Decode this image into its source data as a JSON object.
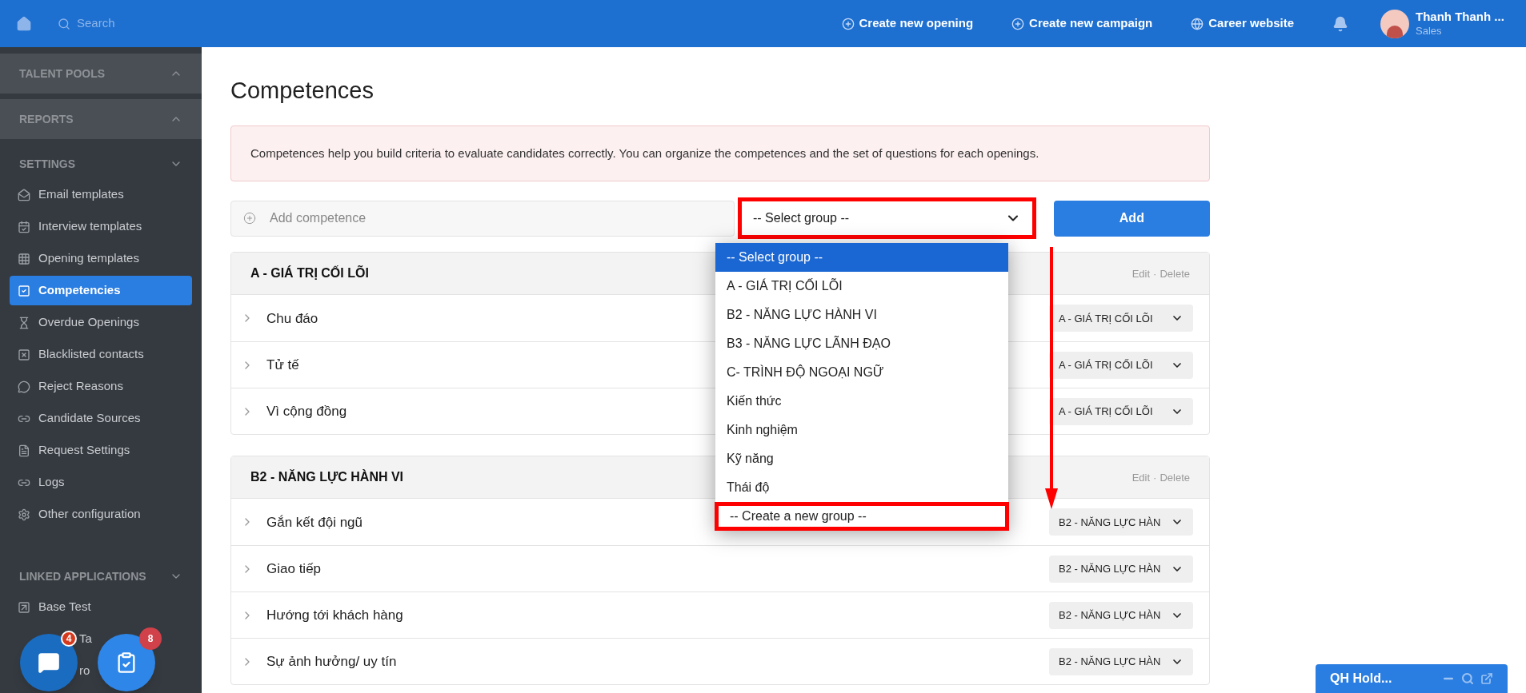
{
  "topbar": {
    "search_placeholder": "Search",
    "links": [
      "Create new opening",
      "Create new campaign",
      "Career website"
    ],
    "user": {
      "name": "Thanh Thanh ...",
      "role": "Sales"
    }
  },
  "sidebar": {
    "sections": [
      {
        "title": "TALENT POOLS",
        "expanded": false
      },
      {
        "title": "REPORTS",
        "expanded": false
      },
      {
        "title": "SETTINGS",
        "expanded": true,
        "items": [
          {
            "label": "Email templates",
            "selected": false
          },
          {
            "label": "Interview templates",
            "selected": false
          },
          {
            "label": "Opening templates",
            "selected": false
          },
          {
            "label": "Competencies",
            "selected": true
          },
          {
            "label": "Overdue Openings",
            "selected": false
          },
          {
            "label": "Blacklisted contacts",
            "selected": false
          },
          {
            "label": "Reject Reasons",
            "selected": false
          },
          {
            "label": "Candidate Sources",
            "selected": false
          },
          {
            "label": "Request Settings",
            "selected": false
          },
          {
            "label": "Logs",
            "selected": false
          },
          {
            "label": "Other configuration",
            "selected": false
          }
        ]
      },
      {
        "title": "LINKED APPLICATIONS",
        "expanded": true,
        "items": [
          {
            "label": "Base Test",
            "selected": false
          },
          {
            "label": "Ta",
            "selected": false
          },
          {
            "label": "ro",
            "selected": false
          }
        ]
      }
    ]
  },
  "floating_buttons": [
    {
      "badge": "4"
    },
    {
      "badge": "8"
    }
  ],
  "page": {
    "title": "Competences",
    "info": "Competences help you build criteria to evaluate candidates correctly. You can organize the competences and the set of questions for each openings.",
    "add_field": {
      "placeholder": "Add competence"
    },
    "group_select": {
      "value": "-- Select group --",
      "highlighted": true
    },
    "add_button": "Add",
    "dropdown": {
      "options": [
        {
          "label": "-- Select group --",
          "selected": true,
          "highlighted": false
        },
        {
          "label": "A - GIÁ TRỊ CỐI LÕI",
          "selected": false,
          "highlighted": false
        },
        {
          "label": "B2 - NĂNG LỰC HÀNH VI",
          "selected": false,
          "highlighted": false
        },
        {
          "label": "B3 - NĂNG LỰC LÃNH ĐẠO",
          "selected": false,
          "highlighted": false
        },
        {
          "label": "C- TRÌNH ĐỘ NGOẠI NGỮ",
          "selected": false,
          "highlighted": false
        },
        {
          "label": "Kiến thức",
          "selected": false,
          "highlighted": false
        },
        {
          "label": "Kinh nghiệm",
          "selected": false,
          "highlighted": false
        },
        {
          "label": "Kỹ năng",
          "selected": false,
          "highlighted": false
        },
        {
          "label": "Thái độ",
          "selected": false,
          "highlighted": false
        },
        {
          "label": "-- Create a new group --",
          "selected": false,
          "highlighted": true
        }
      ]
    },
    "groups": [
      {
        "title": "A - GIÁ TRỊ CỐI LÕI",
        "edit": "Edit",
        "separator": "·",
        "delete": "Delete",
        "items": [
          {
            "name": "Chu đáo",
            "group": "A - GIÁ TRỊ CỐI LÕI"
          },
          {
            "name": "Tử tế",
            "group": "A - GIÁ TRỊ CỐI LÕI"
          },
          {
            "name": "Vì cộng đồng",
            "group": "A - GIÁ TRỊ CỐI LÕI"
          }
        ]
      },
      {
        "title": "B2 - NĂNG LỰC HÀNH VI",
        "edit": "Edit",
        "separator": "·",
        "delete": "Delete",
        "items": [
          {
            "name": "Gắn kết đội ngũ",
            "group": "B2 - NĂNG LỰC HÀN"
          },
          {
            "name": "Giao tiếp",
            "group": "B2 - NĂNG LỰC HÀN"
          },
          {
            "name": "Hướng tới khách hàng",
            "group": "B2 - NĂNG LỰC HÀN"
          },
          {
            "name": "Sự ảnh hưởng/ uy tín",
            "group": "B2 - NĂNG LỰC HÀN"
          }
        ]
      }
    ]
  },
  "chat_window": {
    "title": "QH Hold..."
  }
}
